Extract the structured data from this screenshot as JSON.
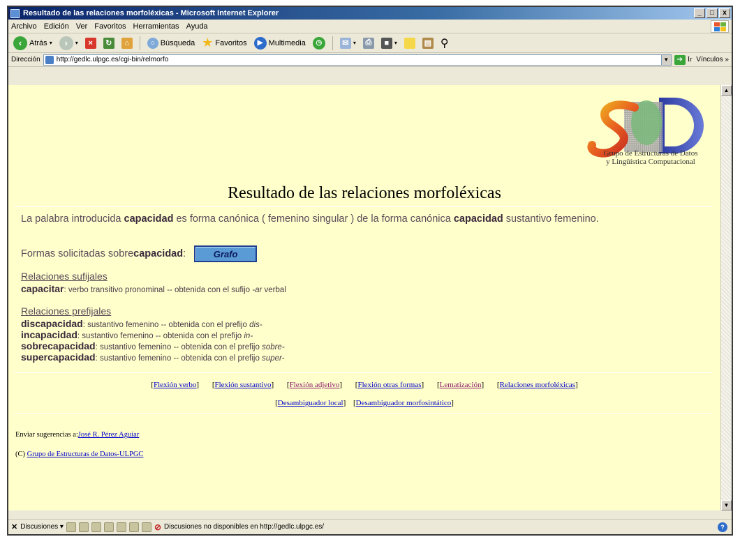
{
  "window": {
    "title": "Resultado de las relaciones morfoléxicas - Microsoft Internet Explorer",
    "minimize": "_",
    "maximize": "□",
    "close": "x"
  },
  "menu": [
    "Archivo",
    "Edición",
    "Ver",
    "Favoritos",
    "Herramientas",
    "Ayuda"
  ],
  "toolbar": {
    "back": "Atrás",
    "search": "Búsqueda",
    "favorites": "Favoritos",
    "multimedia": "Multimedia"
  },
  "address": {
    "label": "Dirección",
    "url": "http://gedlc.ulpgc.es/cgi-bin/relmorfo",
    "go": "Ir",
    "links": "Vínculos »"
  },
  "logo": {
    "line1": "Grupo de Estructuras de Datos",
    "line2": "y Lingüística Computacional"
  },
  "page": {
    "title": "Resultado de las relaciones morfoléxicas",
    "sentence_part1": "La palabra introducida ",
    "sentence_word1": "capacidad",
    "sentence_part2": " es forma canónica ( femenino singular ) de la forma canónica ",
    "sentence_word2": "capacidad",
    "sentence_part3": " sustantivo femenino.",
    "formas_label": "Formas solicitadas sobre ",
    "formas_word": "capacidad",
    "formas_colon": ":",
    "grafo_button": "Grafo"
  },
  "sufijales": {
    "title": "Relaciones sufijales",
    "items": [
      {
        "word": "capacitar",
        "desc": ": verbo transitivo pronominal -- obtenida con el sufijo ",
        "affix": "-ar",
        "tail": " verbal"
      }
    ]
  },
  "prefijales": {
    "title": "Relaciones prefijales",
    "items": [
      {
        "word": "discapacidad",
        "desc": ": sustantivo femenino -- obtenida con el prefijo ",
        "affix": "dis-"
      },
      {
        "word": "incapacidad",
        "desc": ": sustantivo femenino -- obtenida con el prefijo ",
        "affix": "in-"
      },
      {
        "word": "sobrecapacidad",
        "desc": ": sustantivo femenino -- obtenida con el prefijo ",
        "affix": "sobre-"
      },
      {
        "word": "supercapacidad",
        "desc": ": sustantivo femenino -- obtenida con el prefijo ",
        "affix": "super-"
      }
    ]
  },
  "nav": {
    "row1": [
      "Flexión verbo",
      "Flexión sustantivo",
      "Flexión adjetivo",
      "Flexión otras formas",
      "Lematización",
      "Relaciones morfoléxicas"
    ],
    "row2": [
      "Desambiguador local",
      "Desambiguador morfosintático"
    ]
  },
  "footer": {
    "suggest_label": "Enviar sugerencias a:",
    "suggest_link": "José R. Pérez Aguiar",
    "copyright": "(C) ",
    "copyright_link": "Grupo de Estructuras de Datos-ULPGC"
  },
  "status": {
    "discussions": "Discusiones ▾",
    "message": "Discusiones no disponibles en http://gedlc.ulpgc.es/"
  },
  "colors": {
    "page_background": "#ffffcc",
    "link": "#0000cc",
    "grafo_button": "#5b9bd5"
  }
}
